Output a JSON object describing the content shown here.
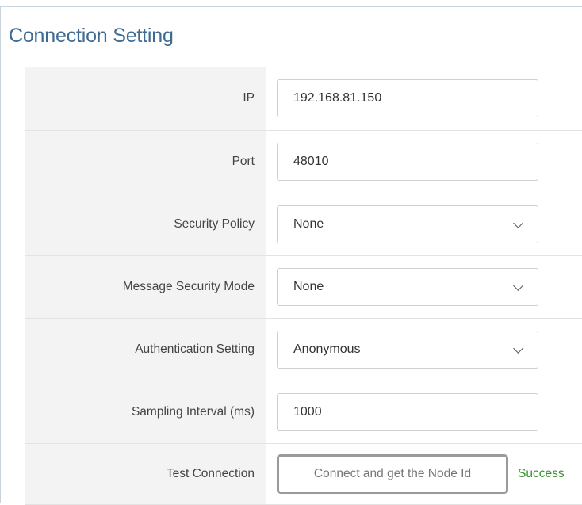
{
  "panel": {
    "title": "Connection Setting"
  },
  "fields": {
    "ip": {
      "label": "IP",
      "value": "192.168.81.150"
    },
    "port": {
      "label": "Port",
      "value": "48010"
    },
    "security_policy": {
      "label": "Security Policy",
      "value": "None"
    },
    "message_security_mode": {
      "label": "Message Security Mode",
      "value": "None"
    },
    "authentication_setting": {
      "label": "Authentication Setting",
      "value": "Anonymous"
    },
    "sampling_interval": {
      "label": "Sampling Interval (ms)",
      "value": "1000"
    },
    "test_connection": {
      "label": "Test Connection",
      "button_label": "Connect and get the Node Id",
      "status": "Success"
    }
  },
  "icons": {
    "dropdown": "chevron-down-icon"
  },
  "colors": {
    "title": "#3f6b93",
    "label_background": "#f3f3f3",
    "success": "#3a8f2f"
  }
}
